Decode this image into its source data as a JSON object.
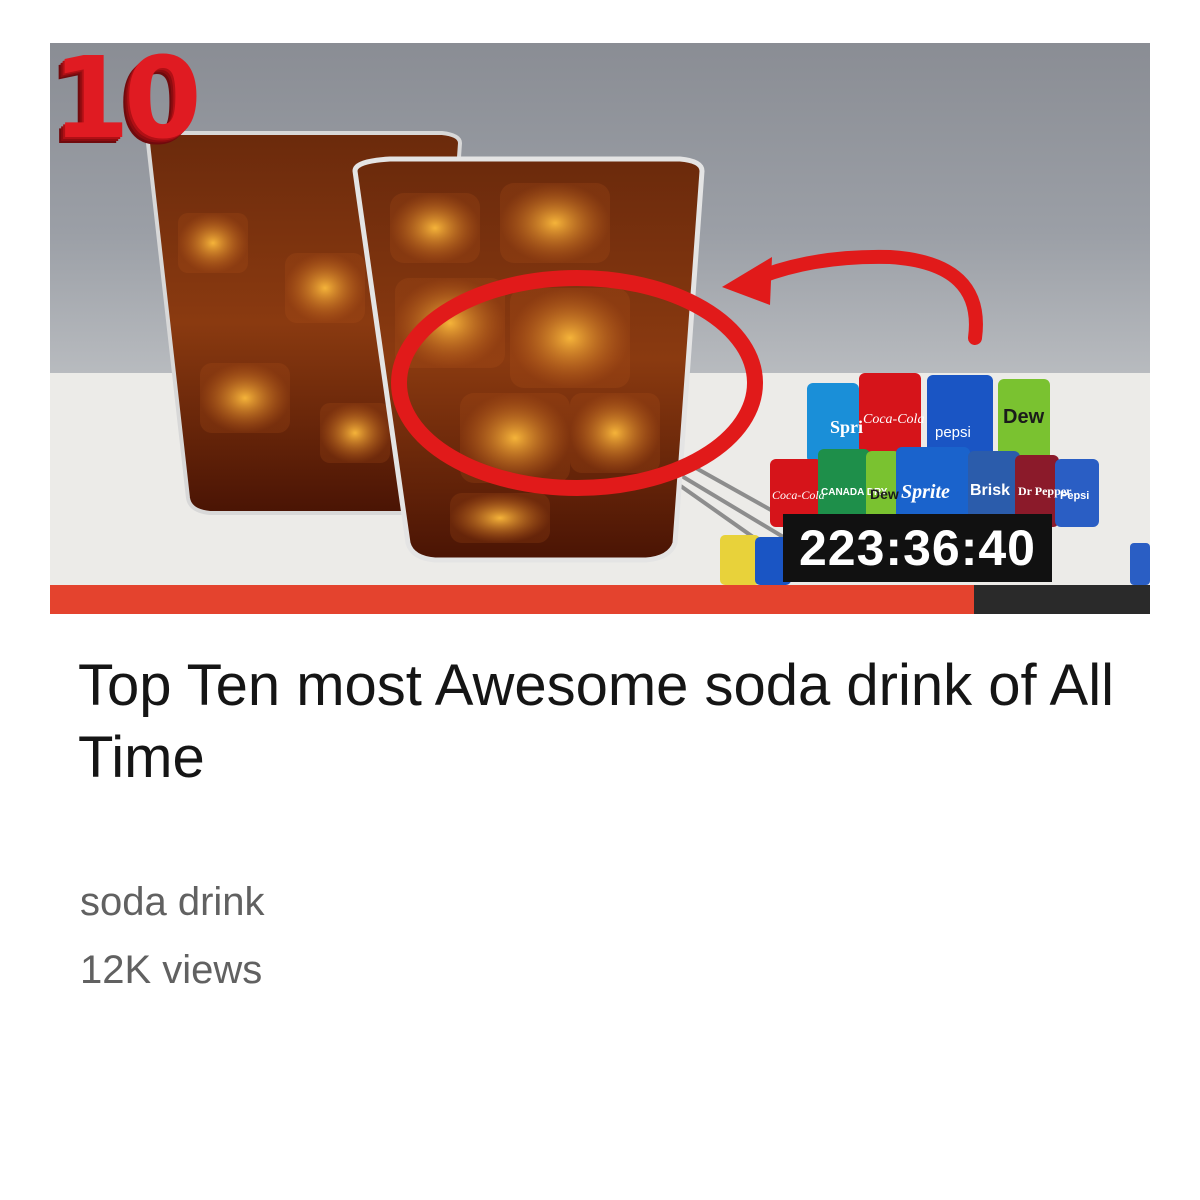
{
  "video": {
    "badge_number": "10",
    "duration": "223:36:40",
    "progress_fraction": 0.84,
    "title": "Top Ten most Awesome soda drink of All Time",
    "channel": "soda drink",
    "views": "12K views",
    "can_labels": [
      "Spri",
      "Coca-Cola",
      "pepsi",
      "Dew",
      "Coca-Cola",
      "CANADA DRY",
      "Dew",
      "Sprite",
      "Brisk",
      "Dr Pepper",
      "Pepsi"
    ]
  },
  "colors": {
    "accent_red": "#e01b22",
    "progress_fill": "#e4432e",
    "progress_track": "#2a2a2a",
    "cola": "#5a1a07"
  },
  "icons": {
    "circle_annotation": "red-circle-icon",
    "arrow_annotation": "curved-arrow-icon"
  }
}
